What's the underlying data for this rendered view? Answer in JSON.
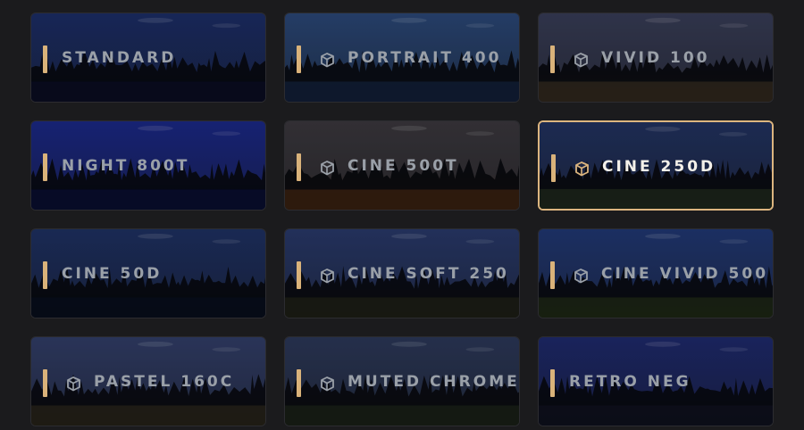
{
  "presets": [
    {
      "name": "STANDARD",
      "icon": false,
      "selected": false,
      "sky": "#1d2f6a",
      "tint": "#0d1030"
    },
    {
      "name": "PORTRAIT 400",
      "icon": true,
      "selected": false,
      "sky": "#2c4a7c",
      "tint": "#1a2e52"
    },
    {
      "name": "VIVID 100",
      "icon": true,
      "selected": false,
      "sky": "#3a3f5a",
      "tint": "#4a3a28"
    },
    {
      "name": "NIGHT 800T",
      "icon": false,
      "selected": false,
      "sky": "#1c2a8c",
      "tint": "#0b1346"
    },
    {
      "name": "CINE 500T",
      "icon": true,
      "selected": false,
      "sky": "#3d3a40",
      "tint": "#5a3114"
    },
    {
      "name": "CINE 250D",
      "icon": true,
      "selected": true,
      "sky": "#233464",
      "tint": "#2e3a24"
    },
    {
      "name": "CINE 50D",
      "icon": false,
      "selected": false,
      "sky": "#1f3266",
      "tint": "#0a1226"
    },
    {
      "name": "CINE SOFT 250",
      "icon": true,
      "selected": false,
      "sky": "#2a3b6e",
      "tint": "#2e2e1c"
    },
    {
      "name": "CINE VIVID 500",
      "icon": true,
      "selected": false,
      "sky": "#223a78",
      "tint": "#2e3a1a"
    },
    {
      "name": "PASTEL 160C",
      "icon": true,
      "selected": false,
      "sky": "#33406c",
      "tint": "#3a3420"
    },
    {
      "name": "MUTED CHROME",
      "icon": true,
      "selected": false,
      "sky": "#2d3a5c",
      "tint": "#27301e"
    },
    {
      "name": "RETRO NEG",
      "icon": false,
      "selected": false,
      "sky": "#1f2b70",
      "tint": "#141628"
    }
  ],
  "colors": {
    "accent": "#d9b27a",
    "background": "#1b1b1d",
    "label": "#9aa0a8",
    "label_selected": "#f4f1ea"
  }
}
